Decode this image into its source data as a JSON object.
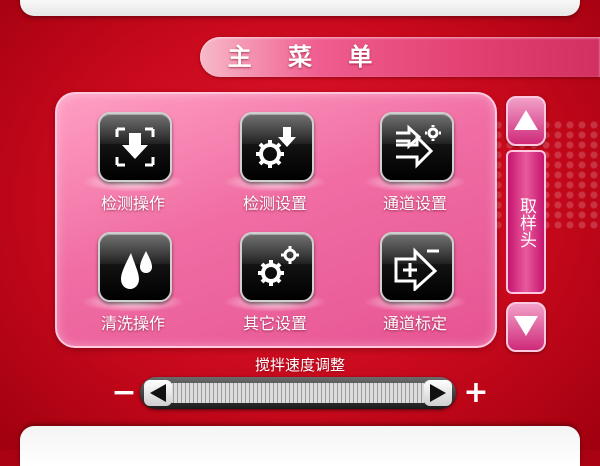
{
  "header": {
    "title": "主 菜 单"
  },
  "menu": {
    "items": [
      {
        "label": "检测操作",
        "icon": "download-frame-icon"
      },
      {
        "label": "检测设置",
        "icon": "gear-download-icon"
      },
      {
        "label": "通道设置",
        "icon": "channel-arrow-gear-icon"
      },
      {
        "label": "清洗操作",
        "icon": "water-drops-icon"
      },
      {
        "label": "其它设置",
        "icon": "gears-icon"
      },
      {
        "label": "通道标定",
        "icon": "channel-plus-minus-icon"
      }
    ]
  },
  "side": {
    "sample_head_label": "取样头",
    "up_icon": "arrow-up-icon",
    "down_icon": "arrow-down-icon"
  },
  "slider": {
    "label": "搅拌速度调整",
    "minus": "−",
    "plus": "+"
  },
  "colors": {
    "background": "#c8091c",
    "panel": "#f06da3",
    "accent": "#cf2a7a",
    "text": "#ffffff"
  }
}
